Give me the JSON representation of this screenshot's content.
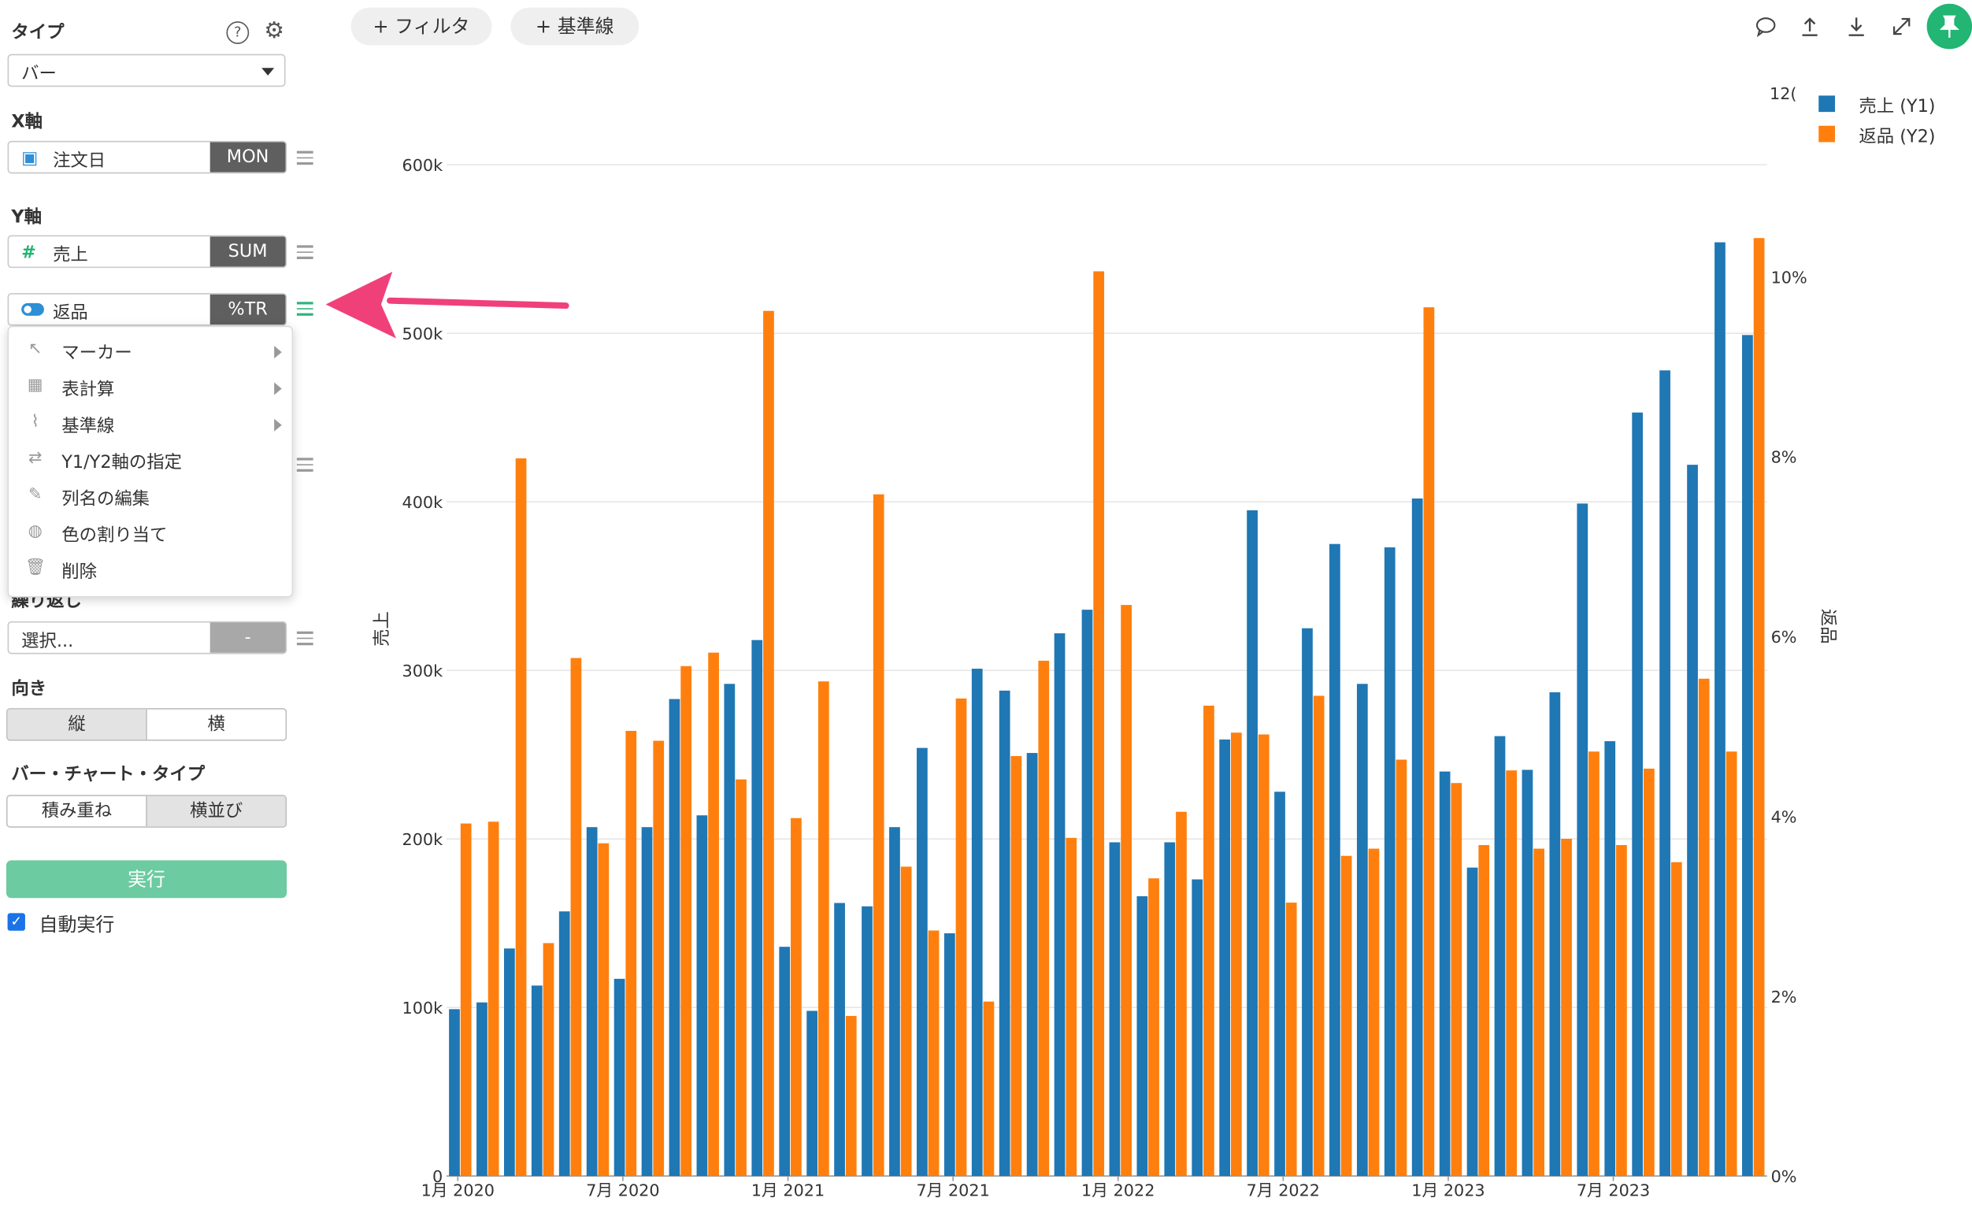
{
  "sidebar": {
    "type_label": "タイプ",
    "type_value": "バー",
    "x_axis_label": "X軸",
    "x_field": {
      "name": "注文日",
      "agg": "MON"
    },
    "y_axis_label": "Y軸",
    "y_field_1": {
      "name": "売上",
      "agg": "SUM",
      "icon": "#"
    },
    "y_field_2": {
      "name": "返品",
      "agg": "%TR"
    },
    "repeat_label": "繰り返し",
    "repeat_value": "選択...",
    "repeat_agg": "-",
    "orientation_label": "向き",
    "orientation_options": [
      "縦",
      "横"
    ],
    "bar_type_label": "バー・チャート・タイプ",
    "bar_type_options": [
      "積み重ね",
      "横並び"
    ],
    "run_label": "実行",
    "auto_run_label": "自動実行"
  },
  "context_menu": {
    "items": [
      {
        "label": "マーカー",
        "icon": "cursor-icon",
        "submenu": true
      },
      {
        "label": "表計算",
        "icon": "table-icon",
        "submenu": true
      },
      {
        "label": "基準線",
        "icon": "line-chart-icon",
        "submenu": true
      },
      {
        "label": "Y1/Y2軸の指定",
        "icon": "swap-icon",
        "submenu": false
      },
      {
        "label": "列名の編集",
        "icon": "edit-icon",
        "submenu": false
      },
      {
        "label": "色の割り当て",
        "icon": "palette-icon",
        "submenu": false
      },
      {
        "label": "削除",
        "icon": "trash-icon",
        "submenu": false
      }
    ]
  },
  "toolbar": {
    "filter_label": "+ フィルタ",
    "baseline_label": "+ 基準線"
  },
  "legend": {
    "truncated_label": "12(",
    "items": [
      {
        "label": "売上 (Y1)",
        "color": "#1f77b4"
      },
      {
        "label": "返品 (Y2)",
        "color": "#ff7f0e"
      }
    ]
  },
  "colors": {
    "sales": "#1f77b4",
    "returns": "#ff7f0e",
    "accent": "#22b573",
    "arrow": "#f0407a"
  },
  "chart_data": {
    "type": "bar",
    "ylabel": "売上",
    "y2label": "返品",
    "ylim": [
      0,
      700000
    ],
    "y2lim": [
      0,
      0.12
    ],
    "y_ticks": [
      "0",
      "100k",
      "200k",
      "300k",
      "400k",
      "500k",
      "600k"
    ],
    "y2_ticks": [
      "0%",
      "2%",
      "4%",
      "6%",
      "8%",
      "10%"
    ],
    "x_tick_labels": [
      "1月 2020",
      "7月 2020",
      "1月 2021",
      "7月 2021",
      "1月 2022",
      "7月 2022",
      "1月 2023",
      "7月 2023"
    ],
    "series": [
      {
        "name": "売上 (Y1)",
        "axis": "y1",
        "values": [
          99000,
          103000,
          135000,
          113000,
          157000,
          207000,
          117000,
          207000,
          283000,
          214000,
          292000,
          318000,
          136000,
          98000,
          162000,
          160000,
          207000,
          254000,
          144000,
          301000,
          288000,
          251000,
          322000,
          336000,
          198000,
          166000,
          198000,
          176000,
          259000,
          395000,
          228000,
          325000,
          375000,
          292000,
          373000,
          402000,
          240000,
          183000,
          261000,
          241000,
          287000,
          399000,
          258000,
          453000,
          478000,
          422000,
          554000,
          499000
        ]
      },
      {
        "name": "返品 (Y2)",
        "axis": "y2",
        "values": [
          0.0392,
          0.0394,
          0.0798,
          0.0259,
          0.0576,
          0.037,
          0.0495,
          0.0484,
          0.0567,
          0.0582,
          0.0441,
          0.0962,
          0.0398,
          0.055,
          0.0178,
          0.0758,
          0.0344,
          0.0273,
          0.0531,
          0.0194,
          0.0467,
          0.0573,
          0.0376,
          0.1006,
          0.0635,
          0.0331,
          0.0405,
          0.0523,
          0.0493,
          0.0491,
          0.0304,
          0.0534,
          0.0356,
          0.0364,
          0.0463,
          0.0966,
          0.0437,
          0.0368,
          0.0451,
          0.0364,
          0.0375,
          0.0472,
          0.0368,
          0.0453,
          0.0349,
          0.0553,
          0.0472,
          0.1043
        ]
      }
    ]
  }
}
